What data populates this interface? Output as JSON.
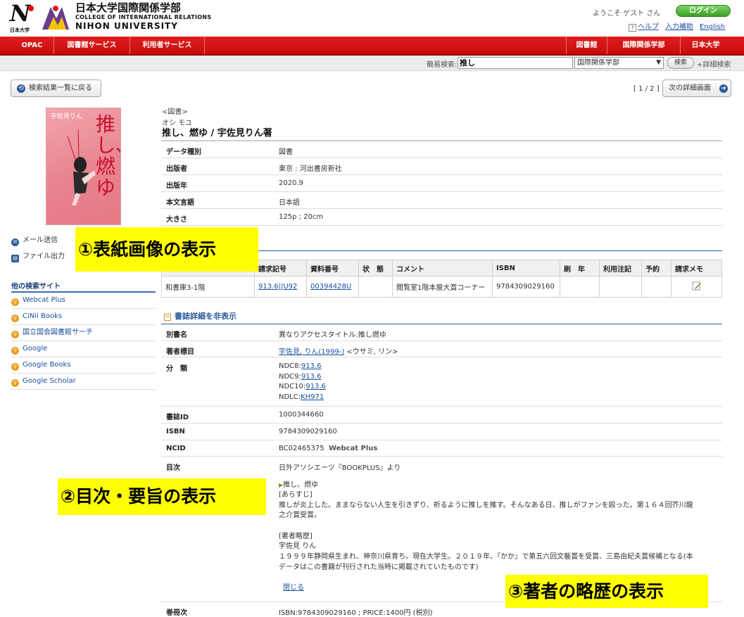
{
  "header": {
    "logo_sub": "日本大学",
    "logo_jp": "日本大学国際関係学部",
    "logo_en1": "COLLEGE OF INTERNATIONAL RELATIONS",
    "logo_en2": "NIHON UNIVERSITY",
    "welcome": "ようこそ ゲスト さん",
    "login": "ログイン",
    "help": "ヘルプ",
    "input_help": "入力補助",
    "english": "English"
  },
  "nav": {
    "left": [
      "OPAC",
      "図書館サービス",
      "利用者サービス"
    ],
    "right": [
      "図書館",
      "国際関係学部",
      "日本大学"
    ]
  },
  "search": {
    "label": "簡易検索:",
    "value": "推し",
    "scope": "国際関係学部",
    "button": "検索",
    "advanced": "+詳細検索"
  },
  "navigation": {
    "back": "検索結果一覧に戻る",
    "pager": "[ 1 / 2 ]",
    "next": "次の詳細画面"
  },
  "cover": {
    "author": "宇佐見りん",
    "title": "推し、燃ゆ"
  },
  "bib": {
    "type": "<図書>",
    "yomi": "オシ モユ",
    "title": "推し、燃ゆ / 宇佐見りん著",
    "rows": [
      {
        "label": "データ種別",
        "value": "図書"
      },
      {
        "label": "出版者",
        "value": "東京 : 河出書房新社"
      },
      {
        "label": "出版年",
        "value": "2020.9"
      },
      {
        "label": "本文言語",
        "value": "日本語"
      },
      {
        "label": "大きさ",
        "value": "125p ; 20cm"
      }
    ]
  },
  "side": {
    "mail": "メール送信",
    "file": "ファイル出力",
    "other_title": "他の検索サイト",
    "other_sites": [
      "Webcat Plus",
      "CiNii Books",
      "国立国会図書館サーチ",
      "Google",
      "Google Books",
      "Google Scholar"
    ]
  },
  "holdings": {
    "headers": [
      "",
      "請求記号",
      "資料番号",
      "状　態",
      "コメント",
      "ISBN",
      "刷　年",
      "利用注記",
      "予約",
      "請求メモ"
    ],
    "row": {
      "location": "和書庫3-1階",
      "call_number": "913.6||U92",
      "item_number": "00394428U",
      "status": "",
      "comment": "閲覧室1階本屋大賞コーナー",
      "isbn": "9784309029160",
      "print_year": "",
      "note": "",
      "reserve": ""
    }
  },
  "detail": {
    "toggle": "書誌詳細を非表示",
    "alt_title_label": "別書名",
    "alt_title": "異なりアクセスタイトル:推し燃ゆ",
    "author_label": "著者標目",
    "author_link": "宇佐見, りん(1999-)",
    "author_yomi": " <ウサミ, リン>",
    "class_label": "分　類",
    "class": [
      {
        "prefix": "NDC8:",
        "link": "913.6"
      },
      {
        "prefix": "NDC9:",
        "link": "913.6"
      },
      {
        "prefix": "NDC10:",
        "link": "913.6"
      },
      {
        "prefix": "NDLC:",
        "link": "KH971"
      }
    ],
    "bibid_label": "書誌ID",
    "bibid": "1000344660",
    "isbn_label": "ISBN",
    "isbn": "9784309029160",
    "ncid_label": "NCID",
    "ncid": "BC02465375",
    "ncid_link": "Webcat Plus",
    "toc_label": "目次",
    "toc_source": "日外アソシエーツ『BOOKPLUS』より",
    "toc_item": "推し、燃ゆ",
    "synopsis_head": "[あらすじ]",
    "synopsis_1": "推しが炎上した。ままならない人生を引きずり、祈るように推しを推す。そんなある日、推しがファンを殴った。第１６４回芥川龍",
    "synopsis_2": "之介賞受賞。",
    "bio_head": "[著者略歴]",
    "bio_name": "宇佐見 りん",
    "bio_1": "１９９９年静岡県生まれ、神奈川県育ち。現在大学生。２０１９年、『かか』で第五六回文藝賞を受賞、三島由紀夫賞候補となる(本",
    "bio_2": "データはこの書籍が刊行された当時に掲載されていたものです)",
    "close": "閉じる",
    "volume_label": "巻冊次",
    "volume": "ISBN:9784309029160 ; PRICE:1400円 (税別)"
  },
  "callouts": {
    "c1": "①表紙画像の表示",
    "c2": "②目次・要旨の表示",
    "c3": "③著者の略歴の表示"
  },
  "colors": {
    "nav_red": "#d41414",
    "link_blue": "#1a4fa0",
    "callout_yellow": "#ffff00",
    "login_green": "#3b9e25"
  }
}
